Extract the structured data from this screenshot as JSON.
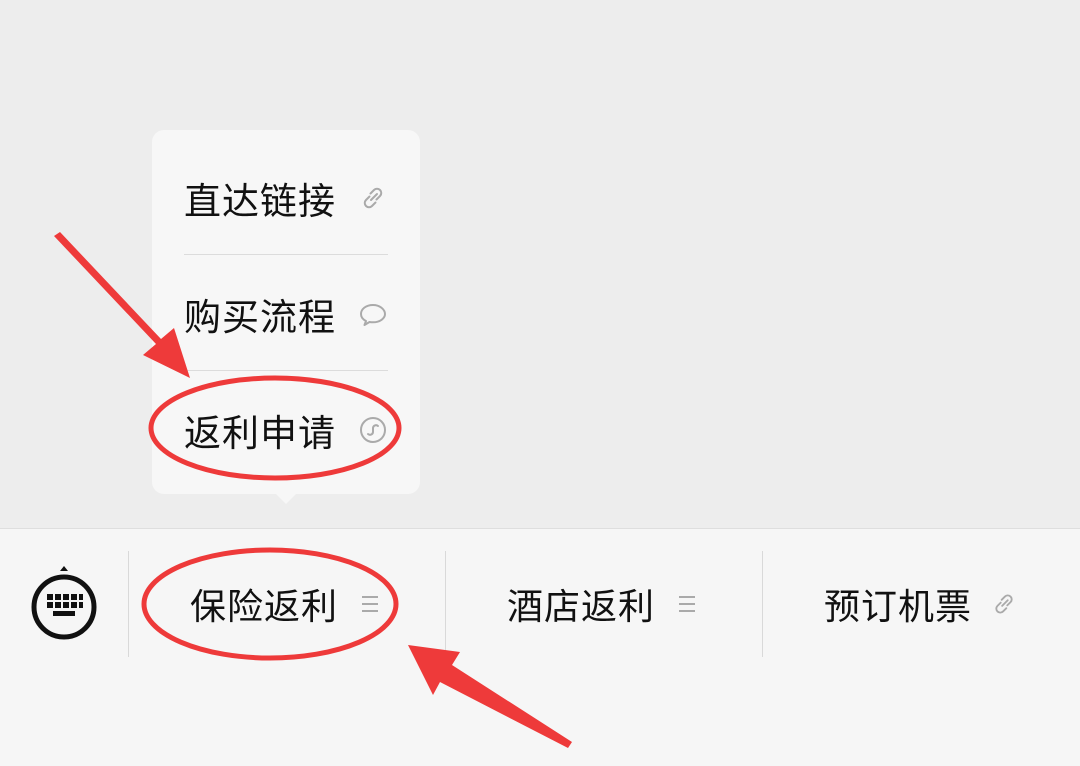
{
  "submenu": {
    "items": [
      {
        "label": "直达链接",
        "icon": "link-icon"
      },
      {
        "label": "购买流程",
        "icon": "chat-bubble-icon"
      },
      {
        "label": "返利申请",
        "icon": "mini-program-icon"
      }
    ]
  },
  "menu_bar": {
    "keyboard_icon": "keyboard-icon",
    "items": [
      {
        "label": "保险返利",
        "icon": "menu-lines-icon"
      },
      {
        "label": "酒店返利",
        "icon": "menu-lines-icon"
      },
      {
        "label": "预订机票",
        "icon": "link-icon"
      }
    ]
  },
  "colors": {
    "annotation_red": "#ee3a3a",
    "chat_background": "#ededed",
    "menu_background": "#f6f6f6",
    "icon_gray": "#aaaaaa"
  }
}
